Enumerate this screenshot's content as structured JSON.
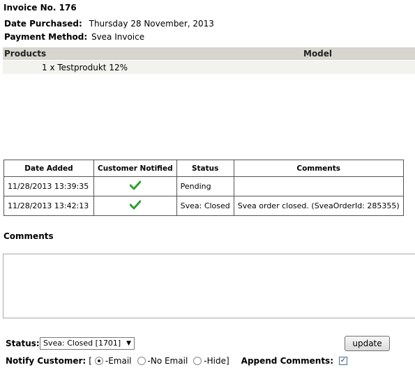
{
  "invoice": {
    "title": "Invoice No. 176",
    "date_label": "Date Purchased:",
    "date_value": "Thursday 28 November, 2013",
    "payment_label": "Payment Method:",
    "payment_value": "Svea Invoice"
  },
  "products": {
    "header_products": "Products",
    "header_model": "Model",
    "rows": [
      {
        "text": "1 x Testprodukt 12%"
      }
    ]
  },
  "history": {
    "headers": [
      "Date Added",
      "Customer Notified",
      "Status",
      "Comments"
    ],
    "rows": [
      {
        "date": "11/28/2013 13:39:35",
        "notified": "check-icon",
        "status": "Pending",
        "comments": ""
      },
      {
        "date": "11/28/2013 13:42:13",
        "notified": "check-icon",
        "status": "Svea: Closed",
        "comments": "Svea order closed. (SveaOrderId: 285355)"
      }
    ],
    "check_color": "#2e9e2e"
  },
  "comments": {
    "label": "Comments",
    "value": ""
  },
  "form": {
    "status_label": "Status:",
    "status_selected": "Svea: Closed [1701]",
    "update_label": "update",
    "notify_label": "Notify Customer:",
    "open_bracket": "[",
    "opt_email": "-Email",
    "opt_no_email": "-No Email",
    "opt_hide": "-Hide]",
    "notify_selected": "email",
    "append_label": "Append Comments:",
    "append_checked": true
  }
}
